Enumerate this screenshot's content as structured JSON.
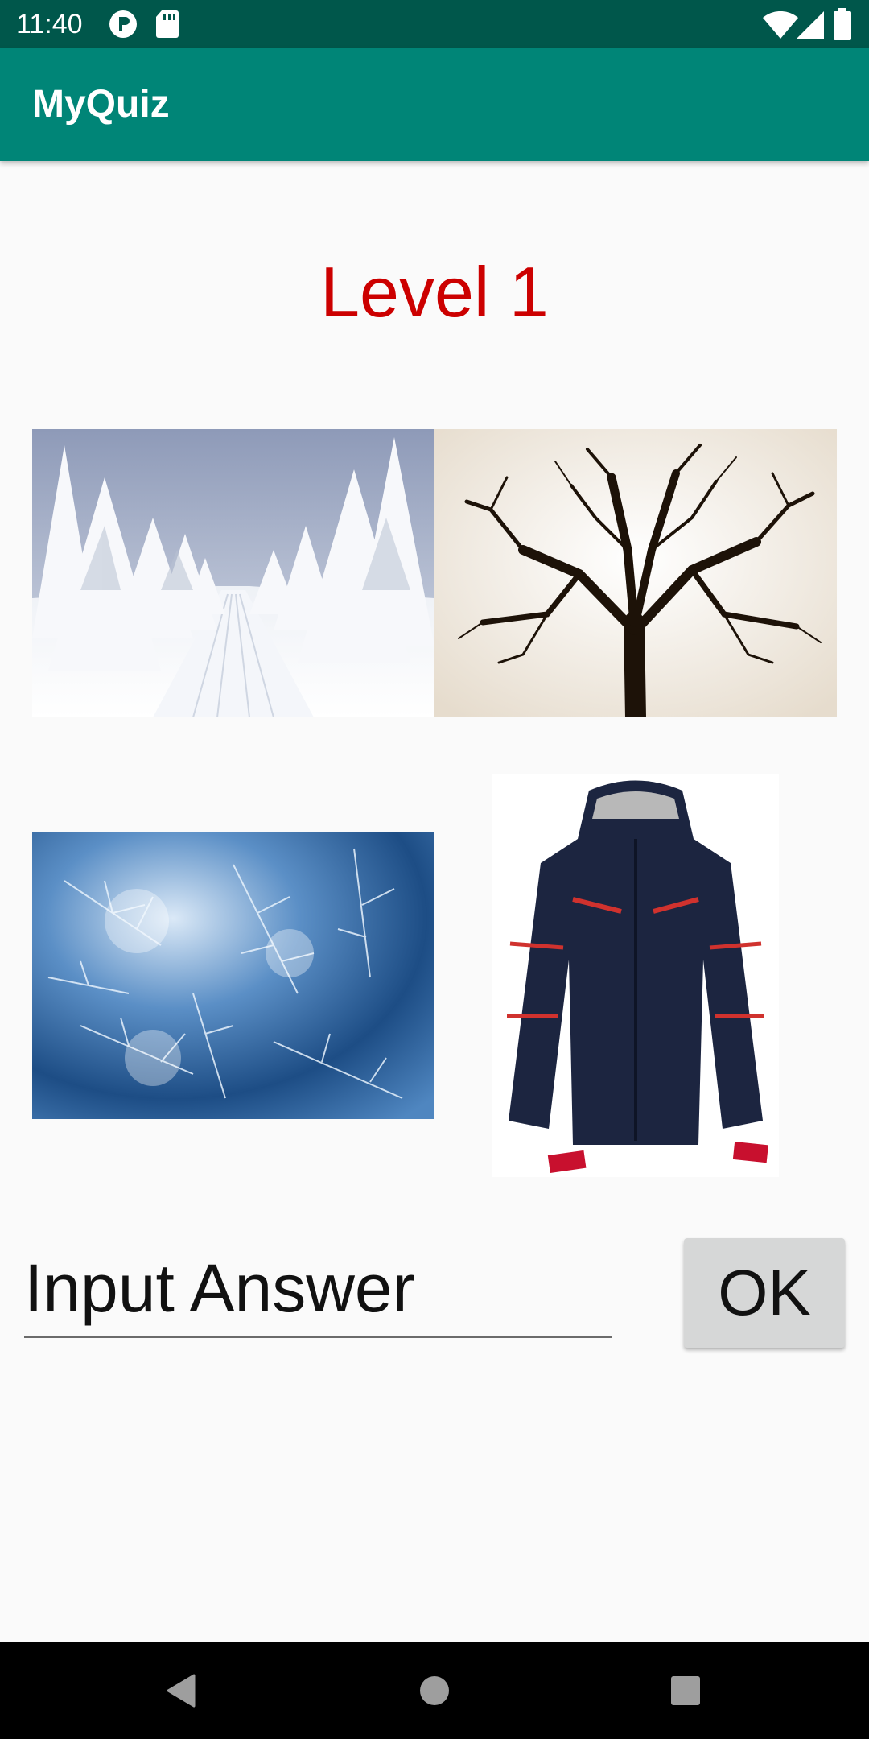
{
  "status": {
    "time": "11:40"
  },
  "appbar": {
    "title": "MyQuiz"
  },
  "main": {
    "level": "Level 1",
    "answer": {
      "placeholder": "Input Answer",
      "value": ""
    },
    "ok_label": "OK"
  },
  "icons": {
    "status_left": [
      "app-notification-icon",
      "sd-card-icon"
    ],
    "status_right": [
      "wifi-icon",
      "cell-signal-icon",
      "battery-icon"
    ],
    "nav": [
      "back-icon",
      "home-icon",
      "recents-icon"
    ]
  },
  "images": [
    "snowy-road-image",
    "bare-tree-image",
    "frost-crystals-image",
    "winter-jacket-image"
  ],
  "colors": {
    "statusbar": "#00574b",
    "appbar": "#008577",
    "level_text": "#cc0000",
    "button": "#d6d7d7"
  }
}
